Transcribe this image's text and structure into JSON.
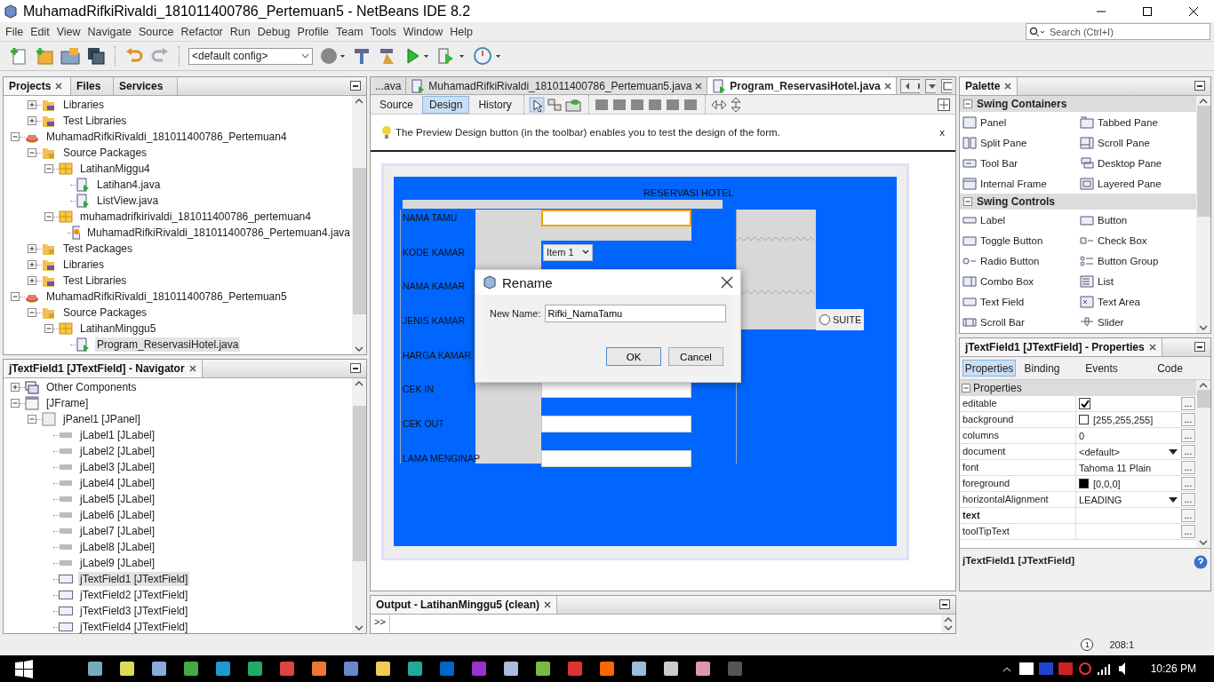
{
  "window": {
    "title": "MuhamadRifkiRivaldi_181011400786_Pertemuan5 - NetBeans IDE 8.2"
  },
  "menu": [
    "File",
    "Edit",
    "View",
    "Navigate",
    "Source",
    "Refactor",
    "Run",
    "Debug",
    "Profile",
    "Team",
    "Tools",
    "Window",
    "Help"
  ],
  "search": {
    "placeholder": "Search (Ctrl+I)"
  },
  "toolbar": {
    "config": "<default config>"
  },
  "projects": {
    "tabs": [
      {
        "label": "Projects",
        "selected": true
      },
      {
        "label": "Files",
        "selected": false
      },
      {
        "label": "Services",
        "selected": false
      }
    ],
    "tree": [
      {
        "children": [
          {
            "label": "Libraries",
            "kind": "library",
            "expanded": false,
            "selected": false
          },
          {
            "label": "Test Libraries",
            "kind": "library",
            "expanded": false,
            "selected": false
          }
        ]
      },
      {
        "label": "MuhamadRifkiRivaldi_181011400786_Pertemuan4",
        "kind": "project",
        "expanded": true,
        "selected": false,
        "children": [
          {
            "label": "Source Packages",
            "kind": "folder",
            "expanded": true,
            "selected": false,
            "children": [
              {
                "label": "LatihanMiggu4",
                "kind": "package",
                "expanded": true,
                "selected": false,
                "children": [
                  {
                    "label": "Latihan4.java",
                    "kind": "java",
                    "selected": false
                  },
                  {
                    "label": "ListView.java",
                    "kind": "java",
                    "selected": false
                  }
                ]
              },
              {
                "label": "muhamadrifkirivaldi_181011400786_pertemuan4",
                "kind": "package",
                "expanded": true,
                "selected": false,
                "children": [
                  {
                    "label": "MuhamadRifkiRivaldi_181011400786_Pertemuan4.java",
                    "kind": "main",
                    "selected": false
                  }
                ]
              }
            ]
          },
          {
            "label": "Test Packages",
            "kind": "folder",
            "expanded": false,
            "selected": false
          },
          {
            "label": "Libraries",
            "kind": "library",
            "expanded": false,
            "selected": false
          },
          {
            "label": "Test Libraries",
            "kind": "library",
            "expanded": false,
            "selected": false
          }
        ]
      },
      {
        "label": "MuhamadRifkiRivaldi_181011400786_Pertemuan5",
        "kind": "project",
        "expanded": true,
        "selected": false,
        "children": [
          {
            "label": "Source Packages",
            "kind": "folder",
            "expanded": true,
            "selected": false,
            "children": [
              {
                "label": "LatihanMinggu5",
                "kind": "package",
                "expanded": true,
                "selected": false,
                "children": [
                  {
                    "label": "Program_ReservasiHotel.java",
                    "kind": "java",
                    "selected": true
                  }
                ]
              }
            ]
          }
        ]
      }
    ]
  },
  "navigator": {
    "title": "jTextField1 [JTextField] - Navigator",
    "tree": [
      {
        "label": "Other Components",
        "kind": "other",
        "expanded": false,
        "selected": false
      },
      {
        "label": "[JFrame]",
        "kind": "frame",
        "expanded": true,
        "selected": false,
        "children": [
          {
            "label": "jPanel1 [JPanel]",
            "kind": "panel",
            "expanded": true,
            "selected": false,
            "children": [
              {
                "label": "jLabel1 [JLabel]",
                "kind": "label",
                "selected": false
              },
              {
                "label": "jLabel2 [JLabel]",
                "kind": "label",
                "selected": false
              },
              {
                "label": "jLabel3 [JLabel]",
                "kind": "label",
                "selected": false
              },
              {
                "label": "jLabel4 [JLabel]",
                "kind": "label",
                "selected": false
              },
              {
                "label": "jLabel5 [JLabel]",
                "kind": "label",
                "selected": false
              },
              {
                "label": "jLabel6 [JLabel]",
                "kind": "label",
                "selected": false
              },
              {
                "label": "jLabel7 [JLabel]",
                "kind": "label",
                "selected": false
              },
              {
                "label": "jLabel8 [JLabel]",
                "kind": "label",
                "selected": false
              },
              {
                "label": "jLabel9 [JLabel]",
                "kind": "label",
                "selected": false
              },
              {
                "label": "jTextField1 [JTextField]",
                "kind": "textfield",
                "selected": true
              },
              {
                "label": "jTextField2 [JTextField]",
                "kind": "textfield",
                "selected": false
              },
              {
                "label": "jTextField3 [JTextField]",
                "kind": "textfield",
                "selected": false
              },
              {
                "label": "jTextField4 [JTextField]",
                "kind": "textfield",
                "selected": false
              }
            ]
          }
        ]
      }
    ]
  },
  "editor": {
    "tabs": [
      {
        "label": "...ava",
        "kind": "partial",
        "selected": false
      },
      {
        "label": "MuhamadRifkiRivaldi_181011400786_Pertemuan5.java",
        "kind": "file",
        "selected": false
      },
      {
        "label": "Program_ReservasiHotel.java",
        "kind": "file",
        "selected": true
      }
    ],
    "views": [
      {
        "label": "Source",
        "selected": false
      },
      {
        "label": "Design",
        "selected": true
      },
      {
        "label": "History",
        "selected": false
      }
    ],
    "hint": {
      "text": "The Preview Design button (in the toolbar) enables you to test the design of the form.",
      "close": "x"
    },
    "form": {
      "title": "RESERVASI HOTEL",
      "rows": [
        {
          "label": "NAMA TAMU",
          "field": {
            "kind": "text",
            "selected": true
          }
        },
        {
          "label": "KODE KAMAR",
          "field": {
            "kind": "combo",
            "value": "Item 1"
          }
        },
        {
          "label": "NAMA KAMAR"
        },
        {
          "label": "JENIS KAMAR"
        },
        {
          "label": "HARGA KAMAR"
        },
        {
          "label": "CEK IN",
          "field": {
            "kind": "text",
            "selected": false
          }
        },
        {
          "label": "CEK OUT",
          "field": {
            "kind": "text",
            "selected": false
          }
        },
        {
          "label": "LAMA MENGINAP",
          "field": {
            "kind": "text",
            "selected": false
          }
        }
      ],
      "radio": {
        "label": "SUITE",
        "checked": false
      }
    },
    "dialog": {
      "title": "Rename",
      "label": "New Name:",
      "value": "Rifki_NamaTamu",
      "buttons": [
        {
          "label": "OK",
          "default": true
        },
        {
          "label": "Cancel",
          "default": false
        }
      ]
    }
  },
  "output": {
    "title": "Output - LatihanMinggu5 (clean)",
    "prompt": ">>"
  },
  "palette": {
    "title": "Palette",
    "sections": [
      {
        "title": "Swing Containers",
        "expanded": true,
        "items": [
          {
            "label": "Panel",
            "kind": "panel"
          },
          {
            "label": "Tabbed Pane",
            "kind": "tabbed"
          },
          {
            "label": "Split Pane",
            "kind": "split"
          },
          {
            "label": "Scroll Pane",
            "kind": "scroll"
          },
          {
            "label": "Tool Bar",
            "kind": "toolbar"
          },
          {
            "label": "Desktop Pane",
            "kind": "desktop"
          },
          {
            "label": "Internal Frame",
            "kind": "frame"
          },
          {
            "label": "Layered Pane",
            "kind": "layered"
          }
        ]
      },
      {
        "title": "Swing Controls",
        "expanded": true,
        "items": [
          {
            "label": "Label",
            "kind": "label"
          },
          {
            "label": "Button",
            "kind": "button"
          },
          {
            "label": "Toggle Button",
            "kind": "button"
          },
          {
            "label": "Check Box",
            "kind": "check"
          },
          {
            "label": "Radio Button",
            "kind": "radio"
          },
          {
            "label": "Button Group",
            "kind": "group"
          },
          {
            "label": "Combo Box",
            "kind": "combo"
          },
          {
            "label": "List",
            "kind": "list"
          },
          {
            "label": "Text Field",
            "kind": "field"
          },
          {
            "label": "Text Area",
            "kind": "area"
          },
          {
            "label": "Scroll Bar",
            "kind": "scrollbar"
          },
          {
            "label": "Slider",
            "kind": "slider"
          }
        ]
      }
    ]
  },
  "properties": {
    "title": "jTextField1 [JTextField] - Properties",
    "tabs": [
      {
        "label": "Properties",
        "selected": true
      },
      {
        "label": "Binding",
        "selected": false
      },
      {
        "label": "Events",
        "selected": false
      },
      {
        "label": "Code",
        "selected": false
      }
    ],
    "section": "Properties",
    "rows": [
      {
        "name": "editable",
        "kind": "check",
        "checked": true,
        "modified": false,
        "button": "..."
      },
      {
        "name": "background",
        "kind": "color",
        "color": "#ffffff",
        "value": "[255,255,255]",
        "modified": false,
        "button": "..."
      },
      {
        "name": "columns",
        "kind": "text",
        "value": "0",
        "modified": false,
        "button": "..."
      },
      {
        "name": "document",
        "kind": "choice",
        "value": "<default>",
        "modified": false,
        "button": "..."
      },
      {
        "name": "font",
        "kind": "text",
        "value": "Tahoma 11 Plain",
        "modified": false,
        "button": "..."
      },
      {
        "name": "foreground",
        "kind": "color",
        "color": "#000000",
        "value": "[0,0,0]",
        "modified": false,
        "button": "..."
      },
      {
        "name": "horizontalAlignment",
        "kind": "choice",
        "value": "LEADING",
        "modified": false,
        "button": "..."
      },
      {
        "name": "text",
        "kind": "text",
        "modified": true,
        "button": "..."
      },
      {
        "name": "toolTipText",
        "kind": "text",
        "modified": false,
        "button": "..."
      }
    ],
    "footer": "jTextField1 [JTextField]"
  },
  "status_bar": {
    "notifications": "1",
    "position": "208:1"
  },
  "taskbar": {
    "time": "10:26 PM"
  }
}
